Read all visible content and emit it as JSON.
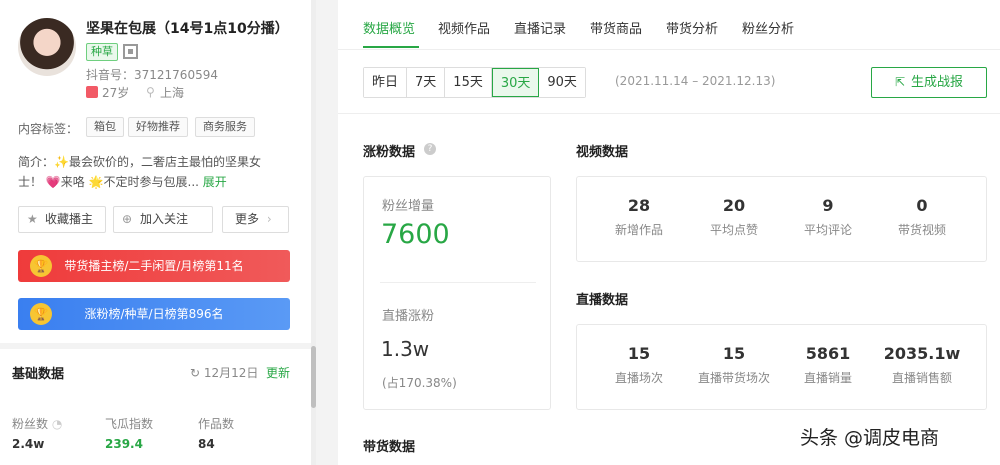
{
  "profile": {
    "name": "坚果在包展（14号1点10分播）",
    "category_tag": "种草",
    "douyin_id": "抖音号：37121760594",
    "age": "27岁",
    "location": "上海",
    "tags_label": "内容标签：",
    "tags": [
      "箱包",
      "好物推荐",
      "商务服务"
    ],
    "bio_line1": "简介：✨最会砍价的，二奢店主最怕的坚果女",
    "bio_line2": "士！ 💗来咯 🌟不定时参与包展...",
    "bio_expand": "展开"
  },
  "actions": {
    "favorite": "收藏播主",
    "follow": "加入关注",
    "more": "更多"
  },
  "ranks": {
    "rank1": "带货播主榜/二手闲置/月榜第11名",
    "rank2": "涨粉榜/种草/日榜第896名"
  },
  "basic": {
    "title": "基础数据",
    "date": "12月12日",
    "update": "更新",
    "stats": [
      {
        "label": "粉丝数",
        "value": "2.4w"
      },
      {
        "label": "飞瓜指数",
        "value": "239.4"
      },
      {
        "label": "作品数",
        "value": "84"
      }
    ]
  },
  "tabs": [
    "数据概览",
    "视频作品",
    "直播记录",
    "带货商品",
    "带货分析",
    "粉丝分析"
  ],
  "ranges": [
    "昨日",
    "7天",
    "15天",
    "30天",
    "90天"
  ],
  "active_range": "30天",
  "date_range": "(2021.11.14 – 2021.12.13)",
  "report_button": "生成战报",
  "growth": {
    "title": "涨粉数据",
    "fans_label": "粉丝增量",
    "fans_value": "7600",
    "live_label": "直播涨粉",
    "live_value": "1.3w",
    "live_ratio": "(占170.38%)"
  },
  "video": {
    "title": "视频数据",
    "metrics": [
      {
        "value": "28",
        "label": "新增作品"
      },
      {
        "value": "20",
        "label": "平均点赞"
      },
      {
        "value": "9",
        "label": "平均评论"
      },
      {
        "value": "0",
        "label": "带货视频"
      }
    ]
  },
  "live": {
    "title": "直播数据",
    "metrics": [
      {
        "value": "15",
        "label": "直播场次"
      },
      {
        "value": "15",
        "label": "直播带货场次"
      },
      {
        "value": "5861",
        "label": "直播销量"
      },
      {
        "value": "2035.1w",
        "label": "直播销售额"
      }
    ]
  },
  "sales_title": "带货数据",
  "watermark": "头条 @调皮电商",
  "colors": {
    "accent": "#28a745",
    "rank_red": "#ef3b3b",
    "rank_blue": "#3a7ff0"
  }
}
